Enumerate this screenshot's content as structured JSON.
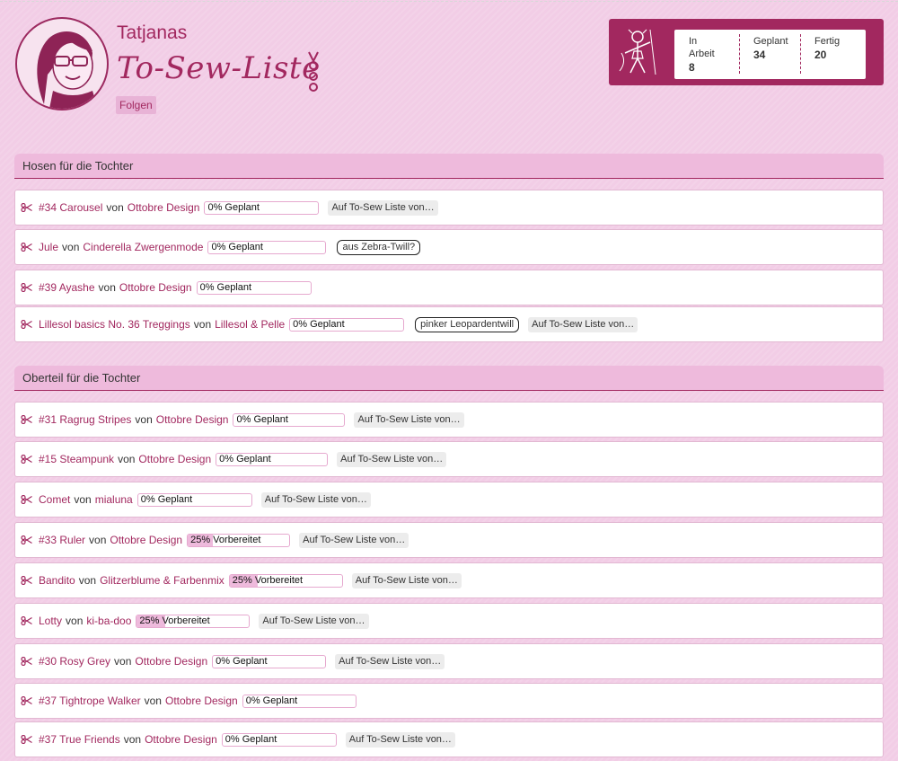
{
  "header": {
    "subtitle": "Tatjanas",
    "title": "To-Sew-Liste",
    "follow_label": "Folgen"
  },
  "stats": [
    {
      "label": "In Arbeit",
      "value": "8"
    },
    {
      "label": "Geplant",
      "value": "34"
    },
    {
      "label": "Fertig",
      "value": "20"
    }
  ],
  "colors": {
    "accent": "#a2285f",
    "background": "#f2cde6",
    "section": "#eebadc"
  },
  "icons": {
    "row": "scissors-icon",
    "stats": "sewing-figure-icon"
  },
  "sections": [
    {
      "title": "Hosen für die Tochter",
      "items": [
        {
          "name": "#34 Carousel",
          "von": "von",
          "designer": "Ottobre Design",
          "status": "0% Geplant",
          "progress": 0,
          "note": "",
          "list": "Auf To-Sew Liste von…"
        },
        {
          "name": "Jule",
          "von": "von",
          "designer": "Cinderella Zwergenmode",
          "status": "0% Geplant",
          "progress": 0,
          "note": "aus Zebra-Twill?",
          "list": ""
        },
        {
          "name": "#39 Ayashe",
          "von": "von",
          "designer": "Ottobre Design",
          "status": "0% Geplant",
          "progress": 0,
          "note": "",
          "list": ""
        },
        {
          "name": "Lillesol basics No. 36 Treggings",
          "von": "von",
          "designer": "Lillesol & Pelle",
          "status": "0% Geplant",
          "progress": 0,
          "note": "pinker Leopardentwill",
          "list": "Auf To-Sew Liste von…"
        }
      ]
    },
    {
      "title": "Oberteil für die Tochter",
      "items": [
        {
          "name": "#31 Ragrug Stripes",
          "von": "von",
          "designer": "Ottobre Design",
          "status": "0% Geplant",
          "progress": 0,
          "note": "",
          "list": "Auf To-Sew Liste von…"
        },
        {
          "name": "#15 Steampunk",
          "von": "von",
          "designer": "Ottobre Design",
          "status": "0% Geplant",
          "progress": 0,
          "note": "",
          "list": "Auf To-Sew Liste von…"
        },
        {
          "name": "Comet",
          "von": "von",
          "designer": "mialuna",
          "status": "0% Geplant",
          "progress": 0,
          "note": "",
          "list": "Auf To-Sew Liste von…"
        },
        {
          "name": "#33 Ruler",
          "von": "von",
          "designer": "Ottobre Design",
          "status": "25% Vorbereitet",
          "progress": 25,
          "note": "",
          "list": "Auf To-Sew Liste von…"
        },
        {
          "name": "Bandito",
          "von": "von",
          "designer": "Glitzerblume & Farbenmix",
          "status": "25% Vorbereitet",
          "progress": 25,
          "note": "",
          "list": "Auf To-Sew Liste von…"
        },
        {
          "name": "Lotty",
          "von": "von",
          "designer": "ki-ba-doo",
          "status": "25% Vorbereitet",
          "progress": 25,
          "note": "",
          "list": "Auf To-Sew Liste von…"
        },
        {
          "name": "#30 Rosy Grey",
          "von": "von",
          "designer": "Ottobre Design",
          "status": "0% Geplant",
          "progress": 0,
          "note": "",
          "list": "Auf To-Sew Liste von…"
        },
        {
          "name": "#37 Tightrope Walker",
          "von": "von",
          "designer": "Ottobre Design",
          "status": "0% Geplant",
          "progress": 0,
          "note": "",
          "list": ""
        },
        {
          "name": "#37 True Friends",
          "von": "von",
          "designer": "Ottobre Design",
          "status": "0% Geplant",
          "progress": 0,
          "note": "",
          "list": "Auf To-Sew Liste von…"
        }
      ]
    }
  ]
}
